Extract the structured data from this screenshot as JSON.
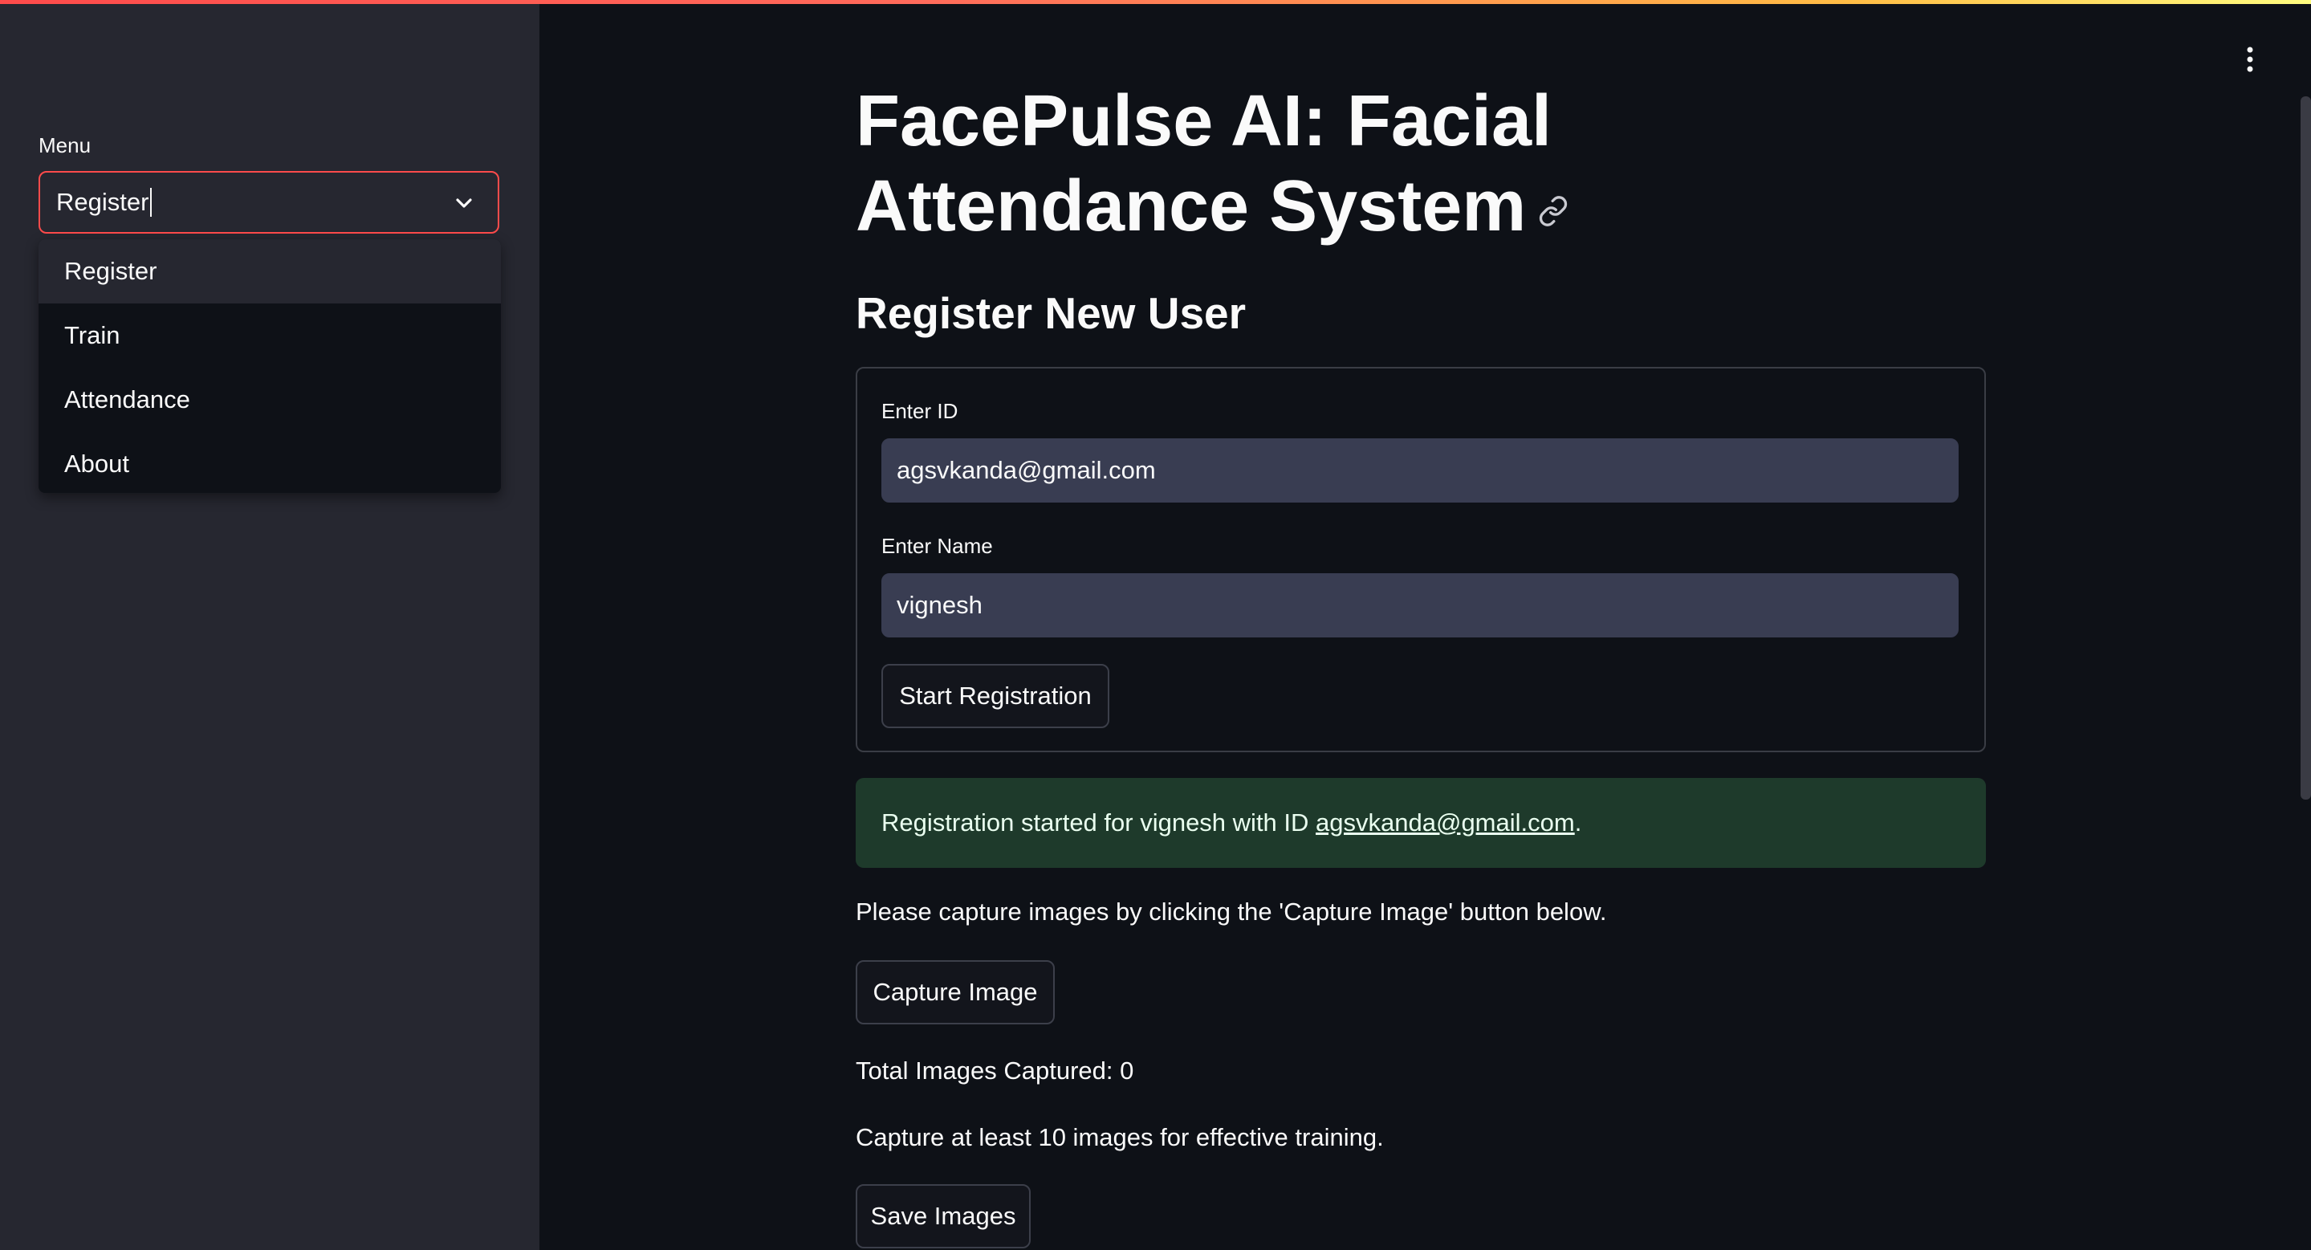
{
  "sidebar": {
    "menu_label": "Menu",
    "selected_value": "Register",
    "options": [
      "Register",
      "Train",
      "Attendance",
      "About"
    ]
  },
  "main": {
    "title": "FacePulse AI: Facial Attendance System",
    "subtitle": "Register New User",
    "form": {
      "id_label": "Enter ID",
      "id_value": "agsvkanda@gmail.com",
      "name_label": "Enter Name",
      "name_value": "vignesh",
      "start_button": "Start Registration"
    },
    "success": {
      "prefix": "Registration started for vignesh with ID ",
      "email": "agsvkanda@gmail.com",
      "suffix": "."
    },
    "capture_instruction": "Please capture images by clicking the 'Capture Image' button below.",
    "capture_button": "Capture Image",
    "total_captured": "Total Images Captured: 0",
    "min_note": "Capture at least 10 images for effective training.",
    "save_button": "Save Images"
  },
  "colors": {
    "accent": "#ff4b4b",
    "background": "#0e1117",
    "sidebar": "#262730",
    "input_bg": "#393d52",
    "success_bg": "#1e3a2b"
  },
  "icons": {
    "dropdown": "chevron-down-icon",
    "anchor": "link-icon",
    "menu": "kebab-menu-icon"
  }
}
